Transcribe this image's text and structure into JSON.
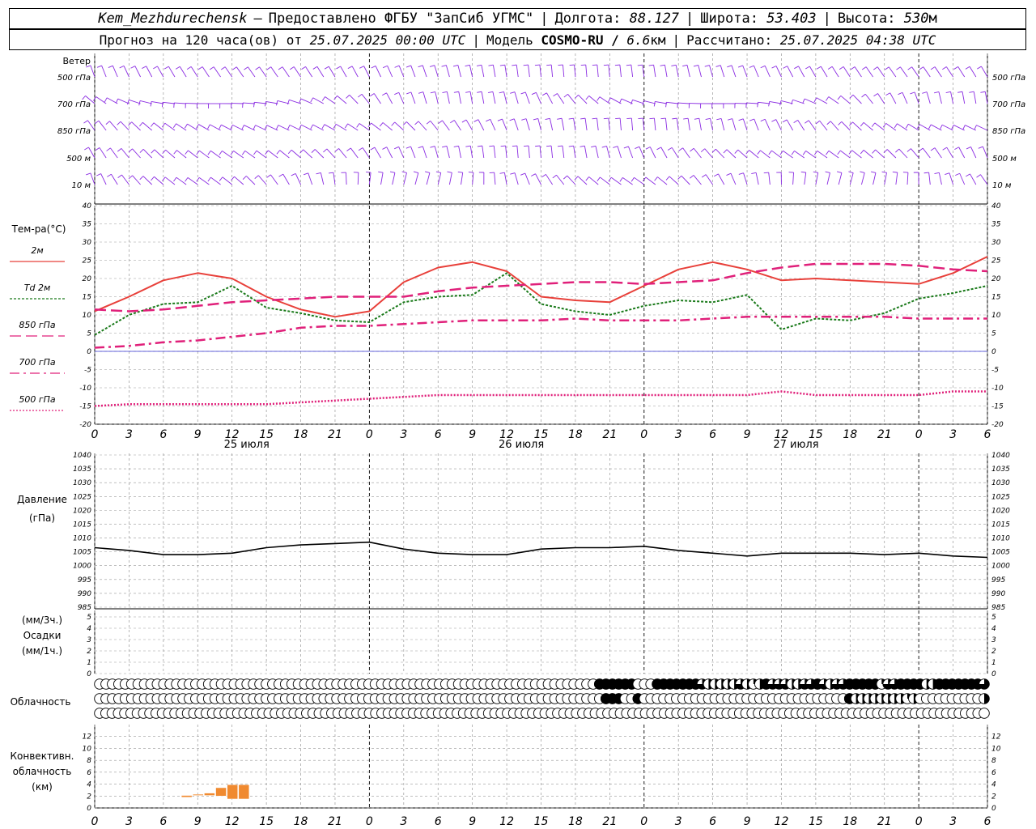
{
  "header": {
    "station": "Kem_Mezhdurechensk",
    "dash": "—",
    "provided": "Предоставлено ФГБУ \"ЗапСиб УГМС\"",
    "lon_label": "Долгота:",
    "lon": "88.127",
    "lat_label": "Широта:",
    "lat": "53.403",
    "alt_label": "Высота:",
    "alt": "530",
    "alt_unit": "м",
    "forecast_label": "Прогноз на 120 часа(ов) от",
    "forecast_time": "25.07.2025 00:00 UTC",
    "model_label": "Модель",
    "model": "COSMO-RU /",
    "res": "6.6",
    "res_unit": "км",
    "calc_label": "Рассчитано:",
    "calc_time": "25.07.2025 04:38 UTC"
  },
  "colors": {
    "wind": "#8a2be2",
    "t2m": "#e8403a",
    "td2m": "#1a7a1a",
    "t850": "#e0207a",
    "t700": "#e0207a",
    "t500": "#e0207a",
    "pressure": "#000000",
    "convective": "#f08a30",
    "grid": "#999999",
    "zero_line": "#3030d0"
  },
  "chart_data": [
    {
      "type": "wind_barbs",
      "panel_label": "Ветер",
      "levels": [
        "500 гПа",
        "700 гПа",
        "850 гПа",
        "500 м",
        "10 м"
      ],
      "x_hours": [
        0,
        3,
        6,
        9,
        12,
        15,
        18,
        21,
        24,
        27,
        30,
        33,
        36,
        39,
        42,
        45,
        48,
        51,
        54,
        57,
        60,
        63,
        66,
        69,
        72,
        75,
        78
      ]
    },
    {
      "type": "line",
      "panel_label": "Тем-ра(°C)",
      "ylim": [
        -20,
        40
      ],
      "yticks": [
        -20,
        -15,
        -10,
        -5,
        0,
        5,
        10,
        15,
        20,
        25,
        30,
        35,
        40
      ],
      "x": [
        0,
        3,
        6,
        9,
        12,
        15,
        18,
        21,
        24,
        27,
        30,
        33,
        36,
        39,
        42,
        45,
        48,
        51,
        54,
        57,
        60,
        63,
        66,
        69,
        72,
        75,
        78
      ],
      "series": [
        {
          "name": "2м",
          "values": [
            11,
            15,
            19.5,
            21.5,
            20,
            15,
            11.5,
            9.5,
            11,
            19,
            23,
            24.5,
            22,
            15,
            14,
            13.5,
            18,
            22.5,
            24.5,
            22.5,
            19.5,
            20,
            19.5,
            19,
            18.5,
            21.5,
            26
          ]
        },
        {
          "name": "Td 2м",
          "values": [
            4.5,
            10,
            13,
            13.5,
            18,
            12,
            10.5,
            8.5,
            8,
            13.5,
            15,
            15.5,
            21.5,
            13,
            11,
            10,
            12.5,
            14,
            13.5,
            15.5,
            6,
            9,
            8.5,
            10.5,
            14.5,
            16,
            18
          ]
        },
        {
          "name": "850 гПа",
          "values": [
            11.5,
            11,
            11.5,
            12.5,
            13.5,
            14,
            14.5,
            15,
            15,
            15,
            16.5,
            17.5,
            18,
            18.5,
            19,
            19,
            18.5,
            19,
            19.5,
            21.5,
            23,
            24,
            24,
            24,
            23.5,
            22.5,
            22
          ]
        },
        {
          "name": "700 гПа",
          "values": [
            1,
            1.5,
            2.5,
            3,
            4,
            5,
            6.5,
            7,
            7,
            7.5,
            8,
            8.5,
            8.5,
            8.5,
            9,
            8.5,
            8.5,
            8.5,
            9,
            9.5,
            9.5,
            9.5,
            9.5,
            9.5,
            9,
            9,
            9
          ]
        },
        {
          "name": "500 гПа",
          "values": [
            -15,
            -14.5,
            -14.5,
            -14.5,
            -14.5,
            -14.5,
            -14,
            -13.5,
            -13,
            -12.5,
            -12,
            -12,
            -12,
            -12,
            -12,
            -12,
            -12,
            -12,
            -12,
            -12,
            -11,
            -12,
            -12,
            -12,
            -12,
            -11,
            -11
          ]
        }
      ],
      "day_labels": [
        "25 июля",
        "26 июля",
        "27 июля"
      ],
      "x_ticklabels": [
        "0",
        "3",
        "6",
        "9",
        "12",
        "15",
        "18",
        "21",
        "0",
        "3",
        "6",
        "9",
        "12",
        "15",
        "18",
        "21",
        "0",
        "3",
        "6",
        "9",
        "12",
        "15",
        "18",
        "21",
        "0",
        "3",
        "6"
      ]
    },
    {
      "type": "line",
      "panel_label": "Давление",
      "unit_label": "(гПа)",
      "ylim": [
        985,
        1040
      ],
      "yticks": [
        985,
        990,
        995,
        1000,
        1005,
        1010,
        1015,
        1020,
        1025,
        1030,
        1035,
        1040
      ],
      "x": [
        0,
        3,
        6,
        9,
        12,
        15,
        18,
        21,
        24,
        27,
        30,
        33,
        36,
        39,
        42,
        45,
        48,
        51,
        54,
        57,
        60,
        63,
        66,
        69,
        72,
        75,
        78
      ],
      "series": [
        {
          "name": "",
          "values": [
            1006.5,
            1005.5,
            1004,
            1004,
            1004.5,
            1006.5,
            1007.5,
            1008,
            1008.5,
            1006,
            1004.5,
            1004,
            1004,
            1006,
            1006.5,
            1006.5,
            1007,
            1005.5,
            1004.5,
            1003.5,
            1004.5,
            1004.5,
            1004.5,
            1004,
            1004.5,
            1003.5,
            1003
          ]
        }
      ]
    },
    {
      "type": "bar",
      "panel_label": "Осадки",
      "unit_top": "(мм/3ч.)",
      "unit_bottom": "(мм/1ч.)",
      "ylim": [
        0,
        5
      ],
      "yticks": [
        0,
        1,
        2,
        3,
        4,
        5
      ],
      "values": []
    },
    {
      "type": "cloud_symbols",
      "panel_label": "Облачность",
      "rows": [
        {
          "name": "upper",
          "values": [
            0,
            0,
            0,
            0,
            0,
            0,
            0,
            0,
            0,
            0,
            0,
            0,
            0,
            0,
            0,
            0,
            0,
            0,
            0,
            0,
            0,
            0,
            0,
            0,
            0,
            0,
            0,
            0,
            0,
            0,
            0,
            0,
            0,
            0,
            0,
            0,
            0,
            0,
            0,
            0,
            0,
            0,
            0,
            0,
            0,
            0,
            0,
            0,
            0,
            0,
            0,
            0,
            0,
            0,
            0,
            0,
            0,
            0,
            0,
            0,
            0,
            0,
            0,
            0,
            0,
            0,
            0,
            0,
            0,
            0,
            0,
            0,
            0,
            0,
            0,
            0,
            0,
            0,
            1,
            1,
            1,
            1,
            1,
            1,
            0,
            0,
            0,
            1,
            1,
            1,
            1,
            1,
            1,
            1,
            0.75,
            0.5,
            0.5,
            0.5,
            0.5,
            0.5,
            0.75,
            0.5,
            0.25,
            0.5,
            1,
            0.75,
            0.75,
            0.75,
            0.5,
            0.5,
            0.75,
            0.75,
            1,
            0.75,
            0.5,
            0.75,
            0.75,
            1,
            1,
            1,
            1,
            1,
            0.25,
            0.75,
            0.75,
            1,
            1,
            1,
            1,
            0.5,
            0.5,
            1,
            1,
            1,
            1,
            1,
            1,
            1,
            0.75
          ]
        },
        {
          "name": "middle",
          "values": [
            0,
            0,
            0,
            0,
            0,
            0,
            0,
            0,
            0,
            0,
            0,
            0,
            0,
            0,
            0,
            0,
            0,
            0,
            0,
            0,
            0,
            0,
            0,
            0,
            0,
            0,
            0,
            0,
            0,
            0,
            0,
            0,
            0,
            0,
            0,
            0,
            0,
            0,
            0,
            0,
            0,
            0,
            0,
            0,
            0,
            0,
            0,
            0,
            0,
            0,
            0,
            0,
            0,
            0,
            0,
            0,
            0,
            0,
            0,
            0,
            0,
            0,
            0,
            0,
            0,
            0,
            0,
            0,
            0,
            0,
            0,
            0,
            0,
            0,
            0,
            0,
            0,
            0,
            0,
            1,
            1,
            1,
            0,
            0,
            1,
            0,
            0,
            0,
            0,
            0,
            0,
            0,
            0,
            0,
            0,
            0,
            0,
            0,
            0,
            0,
            0,
            0,
            0,
            0,
            0,
            0,
            0,
            0,
            0,
            0,
            0,
            0,
            0,
            0,
            0,
            0,
            0,
            1,
            0.5,
            0.5,
            0.5,
            0.5,
            0.5,
            0.5,
            0.5,
            0.5,
            0.25,
            0.5,
            0,
            0,
            0,
            0,
            0,
            0,
            0,
            0,
            0,
            0,
            0.5
          ]
        },
        {
          "name": "lower",
          "values": [
            0,
            0,
            0,
            0,
            0,
            0,
            0,
            0,
            0,
            0,
            0,
            0,
            0,
            0,
            0,
            0,
            0,
            0,
            0,
            0,
            0,
            0,
            0,
            0,
            0,
            0,
            0,
            0,
            0,
            0,
            0,
            0,
            0,
            0,
            0,
            0,
            0,
            0,
            0,
            0,
            0,
            0,
            0,
            0,
            0,
            0,
            0,
            0,
            0,
            0,
            0,
            0,
            0,
            0,
            0,
            0,
            0,
            0,
            0,
            0,
            0,
            0,
            0,
            0,
            0,
            0,
            0,
            0,
            0,
            0,
            0,
            0,
            0,
            0,
            0,
            0,
            0,
            0,
            0,
            0,
            0,
            0,
            0,
            0,
            0,
            0,
            0,
            0,
            0,
            0,
            0,
            0,
            0,
            0,
            0,
            0,
            0,
            0,
            0,
            0,
            0,
            0,
            0,
            0,
            0,
            0,
            0,
            0,
            0,
            0,
            0,
            0,
            0,
            0,
            0,
            0,
            0,
            0,
            0,
            0,
            0,
            0,
            0,
            0,
            0,
            0,
            0,
            0,
            0,
            0,
            0,
            0,
            0,
            0,
            0,
            0,
            0,
            0,
            0,
            0,
            0,
            0
          ]
        }
      ]
    },
    {
      "type": "bar",
      "panel_label": "Конвективн. облачность (км)",
      "label_lines": [
        "Конвективн.",
        "облачность",
        "(км)"
      ],
      "ylim": [
        0,
        14
      ],
      "yticks": [
        0,
        2,
        4,
        6,
        8,
        10,
        12
      ],
      "bars": [
        {
          "x_hour": 8,
          "base": 1.8,
          "top": 2.1
        },
        {
          "x_hour": 9,
          "base": 2.1,
          "top": 2.3
        },
        {
          "x_hour": 10,
          "base": 2.1,
          "top": 2.5
        },
        {
          "x_hour": 11,
          "base": 2.0,
          "top": 3.4
        },
        {
          "x_hour": 12,
          "base": 1.5,
          "top": 3.9
        },
        {
          "x_hour": 13,
          "base": 1.5,
          "top": 3.9
        }
      ]
    }
  ]
}
